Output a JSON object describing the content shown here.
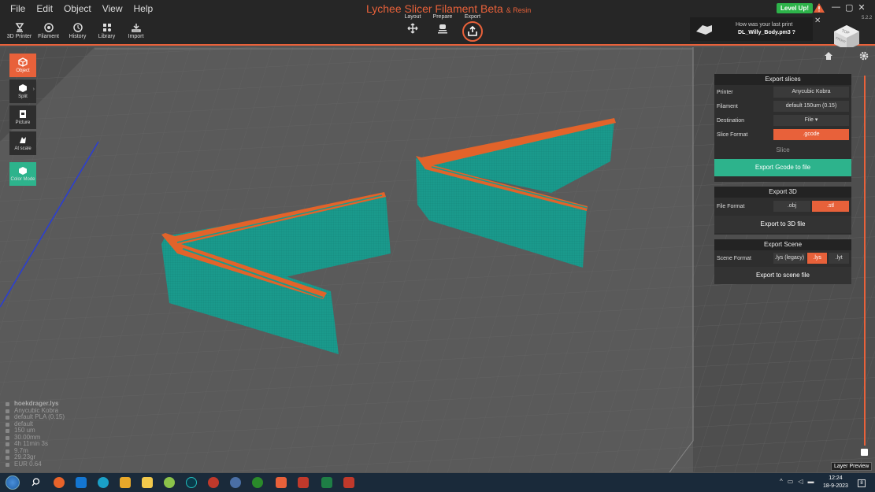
{
  "menu": [
    "File",
    "Edit",
    "Object",
    "View",
    "Help"
  ],
  "app": {
    "title": "Lychee Slicer Filament Beta",
    "subtitle": "& Resin",
    "version": "5.2.2"
  },
  "toolbar": [
    {
      "label": "3D Printer",
      "icon": "printer-icon"
    },
    {
      "label": "Filament",
      "icon": "filament-icon"
    },
    {
      "label": "History",
      "icon": "history-icon"
    },
    {
      "label": "Library",
      "icon": "library-icon"
    },
    {
      "label": "Import",
      "icon": "import-icon"
    }
  ],
  "steps": [
    {
      "label": "Layout",
      "icon": "move-icon"
    },
    {
      "label": "Prepare",
      "icon": "prepare-icon"
    },
    {
      "label": "Export",
      "icon": "export-icon"
    }
  ],
  "level_up": "Level Up!",
  "notification": {
    "line1": "How was your last print",
    "line2": "DL_Willy_Body.pm3 ?"
  },
  "viewcube": {
    "top": "TOP",
    "front": "FRONT"
  },
  "left_tools": [
    {
      "label": "Object",
      "icon": "object-icon"
    },
    {
      "label": "Split",
      "icon": "split-icon"
    },
    {
      "label": "Picture",
      "icon": "picture-icon"
    },
    {
      "label": "At scale",
      "icon": "scale-icon"
    },
    {
      "label": "Color Mode",
      "icon": "color-mode-icon"
    }
  ],
  "export_slices": {
    "title": "Export slices",
    "printer_label": "Printer",
    "printer_value": "Anycubic Kobra",
    "filament_label": "Filament",
    "filament_value": "default 150um  (0.15)",
    "destination_label": "Destination",
    "destination_value": "File ▾",
    "slice_format_label": "Slice Format",
    "slice_format_value": ".gcode",
    "slice_label": "Slice",
    "export_button": "Export Gcode to file"
  },
  "export_3d": {
    "title": "Export 3D",
    "format_label": "File Format",
    "options": [
      ".obj",
      ".stl"
    ],
    "selected": ".stl",
    "export_button": "Export to 3D file"
  },
  "export_scene": {
    "title": "Export Scene",
    "format_label": "Scene Format",
    "options": [
      ".lys (legacy)",
      ".lys",
      ".lyt"
    ],
    "selected": ".lys",
    "export_button": "Export to scene file"
  },
  "layer_preview": "Layer Preview",
  "info": [
    "hoekdrager.lys",
    "Anycubic Kobra",
    "default PLA (0.15)",
    "default",
    "150 um",
    "30.00mm",
    "4h 11min 3s",
    "9.7m",
    "29.23gr",
    "EUR 0.64"
  ],
  "taskbar": {
    "time": "12:24",
    "date": "18-9-2023",
    "notifications": "8"
  },
  "colors": {
    "accent": "#e8613a",
    "green": "#2db38c",
    "model": "#1a9a8c"
  }
}
